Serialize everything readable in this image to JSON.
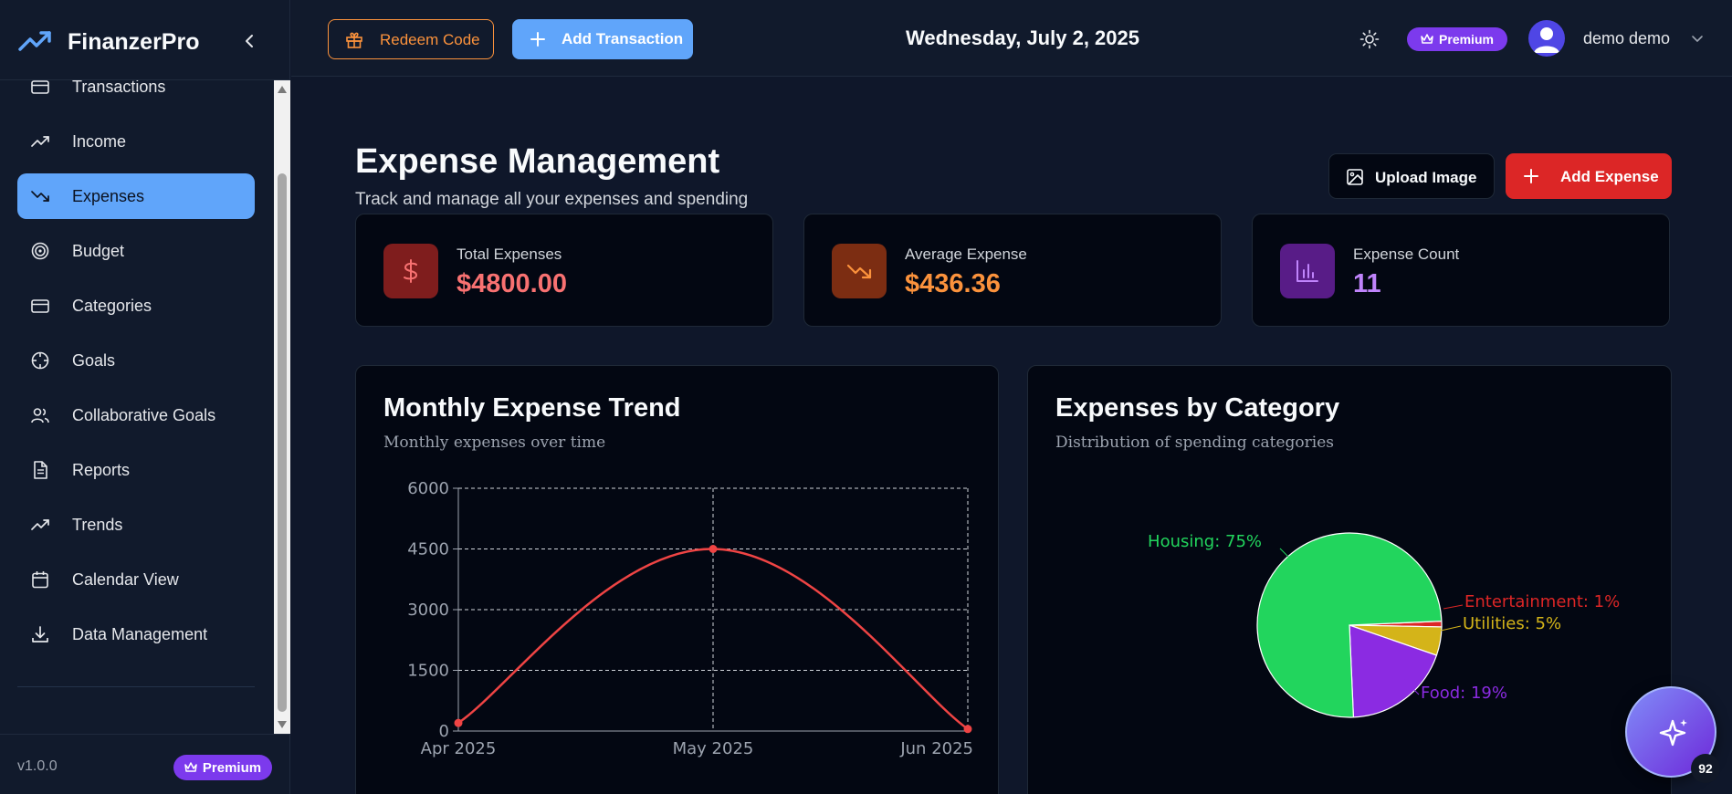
{
  "app": {
    "name": "FinanzerPro",
    "version": "v1.0.0",
    "premium_label": "Premium"
  },
  "sidebar": {
    "items": [
      {
        "label": "Transactions",
        "icon": "credit-card-icon"
      },
      {
        "label": "Income",
        "icon": "trending-up-icon"
      },
      {
        "label": "Expenses",
        "icon": "trending-down-icon",
        "active": true
      },
      {
        "label": "Budget",
        "icon": "target-icon"
      },
      {
        "label": "Categories",
        "icon": "credit-card-icon"
      },
      {
        "label": "Goals",
        "icon": "crosshair-icon"
      },
      {
        "label": "Collaborative Goals",
        "icon": "users-icon"
      },
      {
        "label": "Reports",
        "icon": "file-text-icon"
      },
      {
        "label": "Trends",
        "icon": "trending-up-icon"
      },
      {
        "label": "Calendar View",
        "icon": "calendar-icon"
      },
      {
        "label": "Data Management",
        "icon": "download-icon"
      }
    ]
  },
  "topbar": {
    "redeem_label": "Redeem Code",
    "add_transaction_label": "Add Transaction",
    "date": "Wednesday, July 2, 2025",
    "premium_label": "Premium",
    "username": "demo demo"
  },
  "page": {
    "title": "Expense Management",
    "subtitle": "Track and manage all your expenses and spending",
    "upload_label": "Upload Image",
    "add_expense_label": "Add Expense"
  },
  "stats": [
    {
      "label": "Total Expenses",
      "value": "$4800.00",
      "color": "#f87171",
      "bg": "#7f1d1d",
      "icon": "dollar-icon"
    },
    {
      "label": "Average Expense",
      "value": "$436.36",
      "color": "#fb923c",
      "bg": "#7c2d12",
      "icon": "trending-down-icon"
    },
    {
      "label": "Expense Count",
      "value": "11",
      "color": "#c084fc",
      "bg": "#581c87",
      "icon": "bar-chart-icon"
    }
  ],
  "panels": {
    "trend": {
      "title": "Monthly Expense Trend",
      "subtitle": "Monthly expenses over time"
    },
    "category": {
      "title": "Expenses by Category",
      "subtitle": "Distribution of spending categories"
    }
  },
  "chart_data": [
    {
      "type": "line",
      "categories": [
        "Apr 2025",
        "May 2025",
        "Jun 2025"
      ],
      "series": [
        {
          "values": [
            200,
            4500,
            50
          ],
          "color": "#ef4444"
        }
      ],
      "yticks": [
        "0",
        "1500",
        "3000",
        "4500",
        "6000"
      ],
      "ylim": [
        0,
        6000
      ],
      "grid": true
    },
    {
      "type": "pie",
      "slices": [
        {
          "label": "Housing: 75%",
          "value": 75,
          "color": "#22d55d"
        },
        {
          "label": "Entertainment: 1%",
          "value": 1,
          "color": "#dc2626"
        },
        {
          "label": "Utilities: 5%",
          "value": 5,
          "color": "#d4b419"
        },
        {
          "label": "Food: 19%",
          "value": 19,
          "color": "#8b2be2"
        }
      ]
    }
  ],
  "assistant": {
    "badge": "92"
  }
}
